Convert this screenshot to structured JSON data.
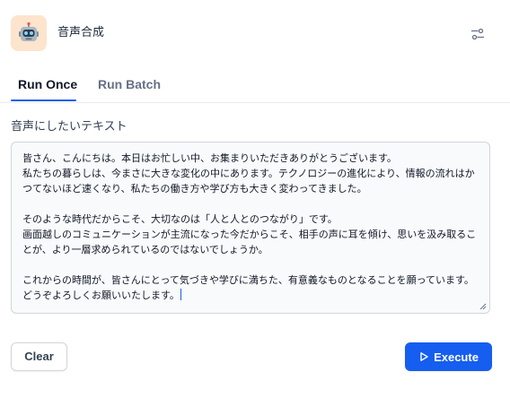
{
  "header": {
    "app_icon": "robot-icon",
    "title": "音声合成",
    "settings_icon": "sliders-icon"
  },
  "tabs": [
    {
      "label": "Run Once",
      "active": true
    },
    {
      "label": "Run Batch",
      "active": false
    }
  ],
  "form": {
    "field_label": "音声にしたいテキスト",
    "text_value": "皆さん、こんにちは。本日はお忙しい中、お集まりいただきありがとうございます。\n私たちの暮らしは、今まさに大きな変化の中にあります。テクノロジーの進化により、情報の流れはかつてないほど速くなり、私たちの働き方や学び方も大きく変わってきました。\n\nそのような時代だからこそ、大切なのは「人と人とのつながり」です。\n画面越しのコミュニケーションが主流になった今だからこそ、相手の声に耳を傾け、思いを汲み取ることが、より一層求められているのではないでしょうか。\n\nこれからの時間が、皆さんにとって気づきや学びに満ちた、有意義なものとなることを願っています。\nどうぞよろしくお願いいたします。"
  },
  "actions": {
    "clear_label": "Clear",
    "execute_label": "Execute",
    "execute_icon": "play-icon"
  },
  "colors": {
    "accent": "#155eef",
    "app_icon_bg": "#fde4cc"
  }
}
